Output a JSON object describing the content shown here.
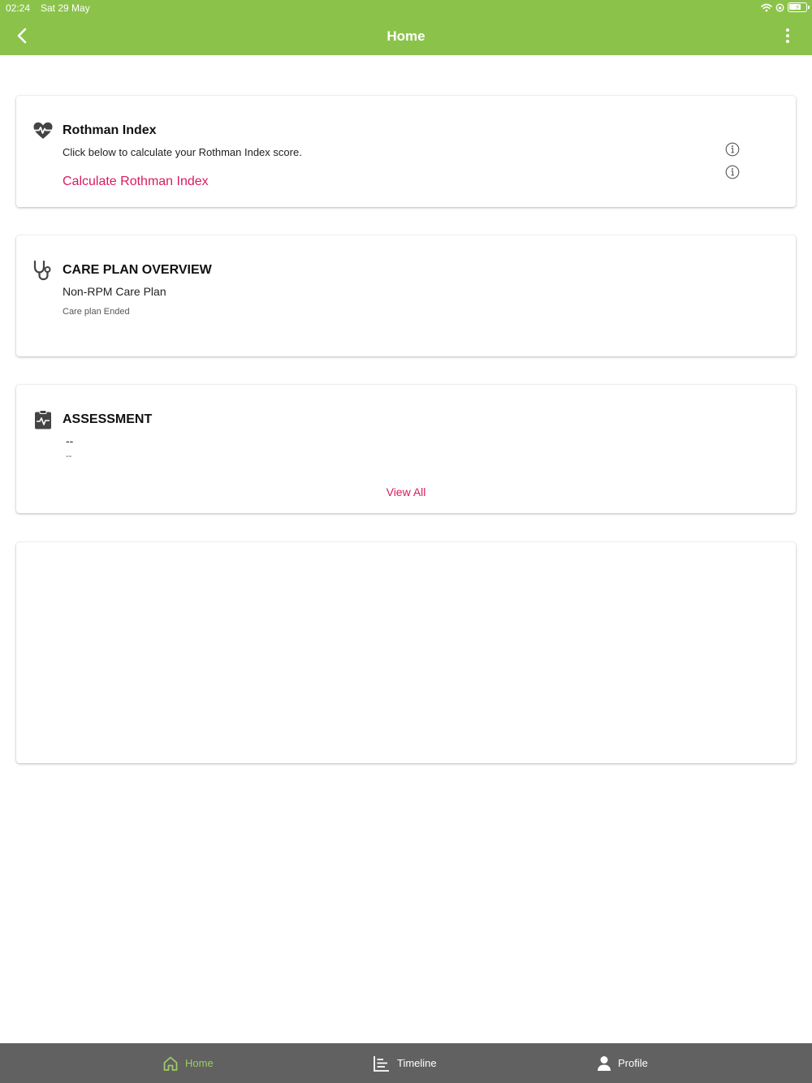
{
  "status_bar": {
    "time": "02:24",
    "date": "Sat 29 May"
  },
  "header": {
    "title": "Home",
    "background_color": "#8bc34a"
  },
  "cards": {
    "rothman": {
      "icon": "heart-pulse-icon",
      "title": "Rothman Index",
      "description": "Click below to calculate your Rothman Index score.",
      "link_label": "Calculate Rothman Index"
    },
    "care_plan": {
      "icon": "stethoscope-icon",
      "title": "CARE PLAN OVERVIEW",
      "plan_name": "Non-RPM Care Plan",
      "status": "Care plan Ended"
    },
    "assessment": {
      "icon": "clipboard-pulse-icon",
      "title": "ASSESSMENT",
      "value": "--",
      "detail": "--",
      "view_all_label": "View All"
    }
  },
  "bottom_nav": {
    "items": [
      {
        "label": "Home",
        "icon": "home-icon",
        "active": true
      },
      {
        "label": "Timeline",
        "icon": "timeline-icon",
        "active": false
      },
      {
        "label": "Profile",
        "icon": "person-icon",
        "active": false
      }
    ]
  },
  "colors": {
    "accent_pink": "#d81b60",
    "nav_active": "#9ccc65",
    "nav_background": "#616161"
  }
}
